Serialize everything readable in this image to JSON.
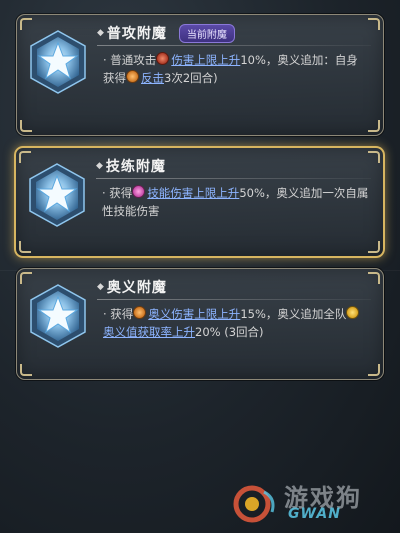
{
  "cards": [
    {
      "title": "普攻附魔",
      "badge": "当前附魔",
      "bullet": "◆",
      "desc_prefix": "· 普通攻击",
      "link1": "伤害上限上升",
      "mid": "10%，奥义追加：自身获得",
      "link2": "反击",
      "suffix": "3次2回合)"
    },
    {
      "title": "技练附魔",
      "bullet": "◆",
      "desc_prefix": "· 获得",
      "link1": "技能伤害上限上升",
      "suffix": "50%，奥义追加一次自属性技能伤害"
    },
    {
      "title": "奥义附魔",
      "bullet": "◆",
      "desc_prefix": "· 获得",
      "link1": "奥义伤害上限上升",
      "mid": "15%，奥义追加全队",
      "link2": "奥义值获取率上升",
      "suffix": "20% (3回合)"
    }
  ],
  "watermark": {
    "text": "游戏狗",
    "sub": "GWAN"
  },
  "colors": {
    "selected_border": "#d7b560",
    "link": "#8db4ff",
    "badge_bg": "#5b4aa8"
  }
}
